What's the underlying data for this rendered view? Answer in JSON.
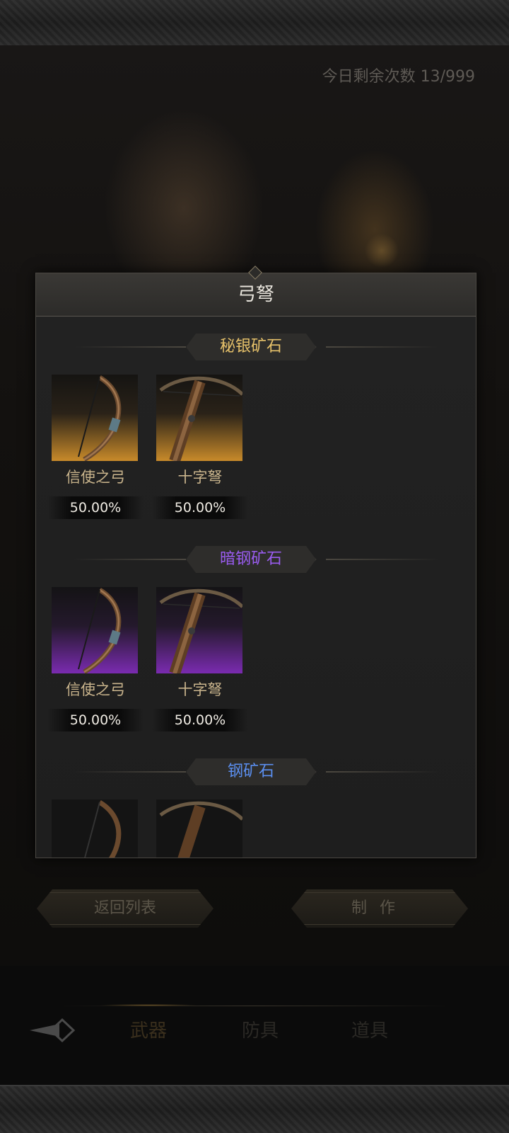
{
  "header": {
    "remaining_label": "今日剩余次数 13/999"
  },
  "dialog": {
    "title": "弓弩",
    "sections": [
      {
        "name": "秘银矿石",
        "color": "#e6c16a",
        "rarity_bg": "gold",
        "items": [
          {
            "name": "信使之弓",
            "chance": "50.00%",
            "icon": "bow-icon"
          },
          {
            "name": "十字弩",
            "chance": "50.00%",
            "icon": "crossbow-icon"
          }
        ]
      },
      {
        "name": "暗钢矿石",
        "color": "#9a5cf0",
        "rarity_bg": "purple",
        "items": [
          {
            "name": "信使之弓",
            "chance": "50.00%",
            "icon": "bow-icon"
          },
          {
            "name": "十字弩",
            "chance": "50.00%",
            "icon": "crossbow-icon"
          }
        ]
      },
      {
        "name": "钢矿石",
        "color": "#5b8ff0",
        "rarity_bg": "dark",
        "items": [
          {
            "name": "",
            "chance": "",
            "icon": "bow-icon"
          },
          {
            "name": "",
            "chance": "",
            "icon": "crossbow-icon"
          }
        ]
      }
    ]
  },
  "buttons": {
    "back_label": "返回列表",
    "make_label": "制作"
  },
  "nav": {
    "back_icon": "diamond-arrow-left-icon",
    "tabs": [
      {
        "label": "武器",
        "active": true
      },
      {
        "label": "防具",
        "active": false
      },
      {
        "label": "道具",
        "active": false
      }
    ]
  }
}
